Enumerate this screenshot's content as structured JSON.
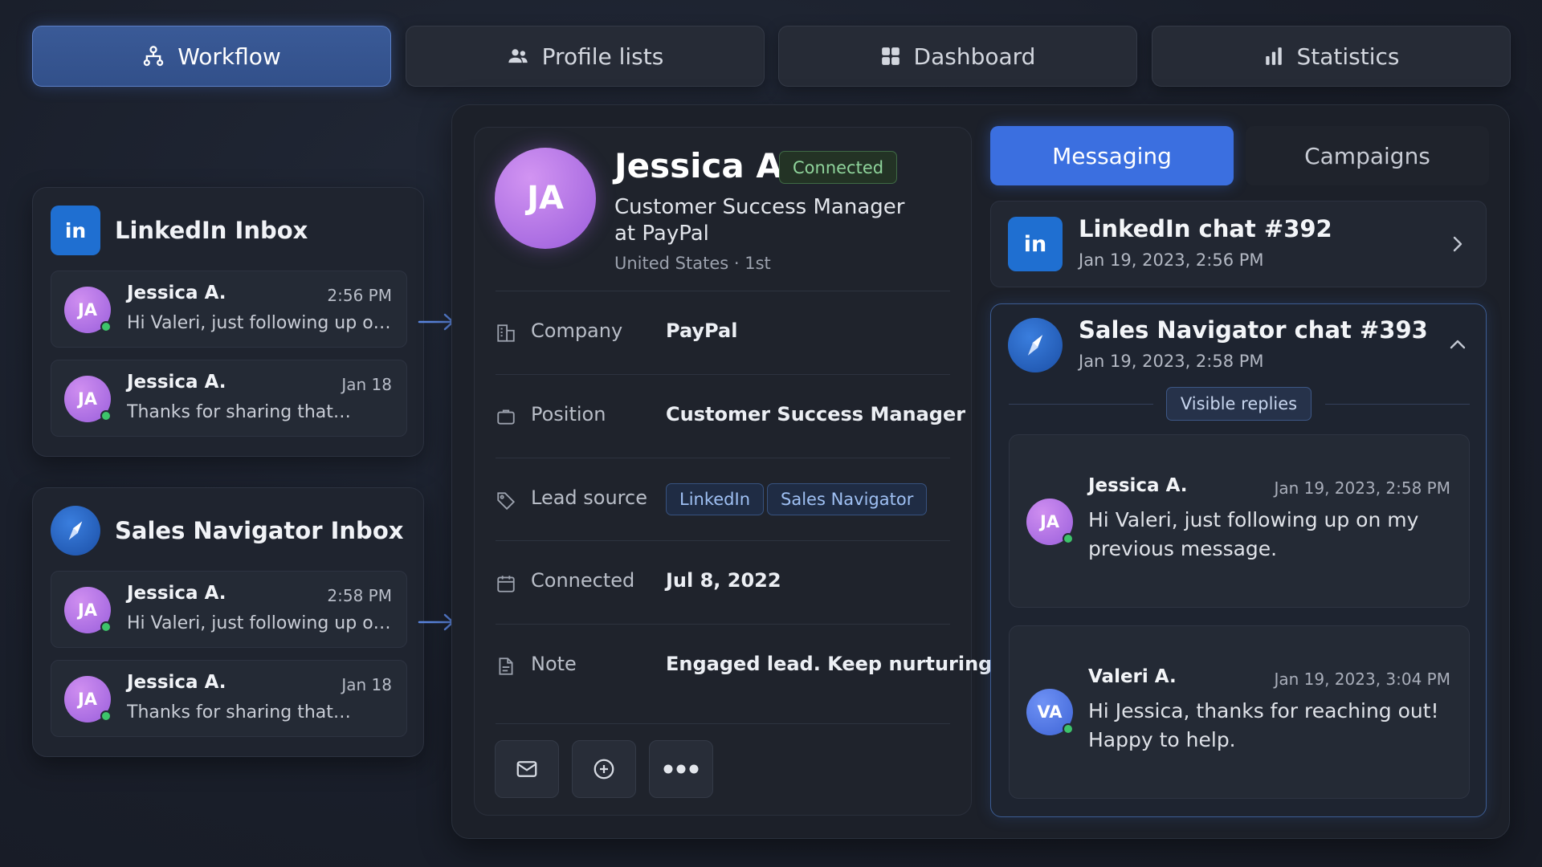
{
  "nav": {
    "tabs": [
      {
        "label": "Workflow",
        "icon": "workflow-icon",
        "active": true
      },
      {
        "label": "Profile lists",
        "icon": "people-icon",
        "active": false
      },
      {
        "label": "Dashboard",
        "icon": "grid-icon",
        "active": false
      },
      {
        "label": "Statistics",
        "icon": "bar-chart-icon",
        "active": false
      }
    ]
  },
  "linkedin_inbox": {
    "title": "LinkedIn Inbox",
    "logo_text": "in",
    "messages": [
      {
        "avatar": "JA",
        "name": "Jessica A.",
        "time": "2:56 PM",
        "text": "Hi Valeri, just following up on my previous message."
      },
      {
        "avatar": "JA",
        "name": "Jessica A.",
        "time": "Jan 18",
        "text": "Thanks for sharing that…"
      }
    ]
  },
  "salesnav_inbox": {
    "title": "Sales Navigator Inbox",
    "messages": [
      {
        "avatar": "JA",
        "name": "Jessica A.",
        "time": "2:58 PM",
        "text": "Hi Valeri, just following up on my previous message."
      },
      {
        "avatar": "JA",
        "name": "Jessica A.",
        "time": "Jan 18",
        "text": "Thanks for sharing that…"
      }
    ]
  },
  "profile": {
    "avatar": "JA",
    "name": "Jessica A.",
    "status": "Connected",
    "title": "Customer Success Manager at PayPal",
    "location": "United States · 1st",
    "fields": {
      "company": {
        "label": "Company",
        "value": "PayPal"
      },
      "position": {
        "label": "Position",
        "value": "Customer Success Manager"
      },
      "lead_source": {
        "label": "Lead source",
        "tags": [
          "LinkedIn",
          "Sales Navigator"
        ]
      },
      "connected": {
        "label": "Connected",
        "value": "Jul 8, 2022"
      },
      "note": {
        "label": "Note",
        "value": "Engaged lead. Keep nurturing."
      }
    }
  },
  "right": {
    "tabs": {
      "messaging": "Messaging",
      "campaigns": "Campaigns"
    },
    "chat_linkedin": {
      "logo_text": "in",
      "title": "LinkedIn chat #392",
      "date": "Jan 19, 2023, 2:56 PM"
    },
    "chat_salesnav": {
      "title": "Sales Navigator chat #393",
      "date": "Jan 19, 2023, 2:58 PM",
      "visible_replies": "Visible replies",
      "messages": [
        {
          "avatar": "JA",
          "name": "Jessica A.",
          "date": "Jan 19, 2023, 2:58 PM",
          "text": "Hi Valeri, just following up on my previous message."
        },
        {
          "avatar": "VA",
          "name": "Valeri A.",
          "date": "Jan 19, 2023, 3:04 PM",
          "text": "Hi Jessica, thanks for reaching out! Happy to help."
        }
      ]
    }
  },
  "colors": {
    "accent": "#3b6fe0",
    "connected": "#8fd49b",
    "online": "#3dc36a"
  }
}
